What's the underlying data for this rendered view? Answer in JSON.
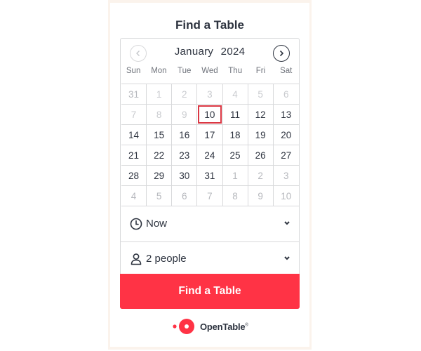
{
  "title": "Find a Table",
  "calendar": {
    "month": "January",
    "year": "2024",
    "weekdays": [
      "Sun",
      "Mon",
      "Tue",
      "Wed",
      "Thu",
      "Fri",
      "Sat"
    ],
    "weeks": [
      [
        {
          "d": "31",
          "s": "muted"
        },
        {
          "d": "1",
          "s": "past"
        },
        {
          "d": "2",
          "s": "past"
        },
        {
          "d": "3",
          "s": "past"
        },
        {
          "d": "4",
          "s": "past"
        },
        {
          "d": "5",
          "s": "past"
        },
        {
          "d": "6",
          "s": "past"
        }
      ],
      [
        {
          "d": "7",
          "s": "past"
        },
        {
          "d": "8",
          "s": "past"
        },
        {
          "d": "9",
          "s": "past"
        },
        {
          "d": "10",
          "s": "selected"
        },
        {
          "d": "11",
          "s": ""
        },
        {
          "d": "12",
          "s": ""
        },
        {
          "d": "13",
          "s": ""
        }
      ],
      [
        {
          "d": "14",
          "s": ""
        },
        {
          "d": "15",
          "s": ""
        },
        {
          "d": "16",
          "s": ""
        },
        {
          "d": "17",
          "s": ""
        },
        {
          "d": "18",
          "s": ""
        },
        {
          "d": "19",
          "s": ""
        },
        {
          "d": "20",
          "s": ""
        }
      ],
      [
        {
          "d": "21",
          "s": ""
        },
        {
          "d": "22",
          "s": ""
        },
        {
          "d": "23",
          "s": ""
        },
        {
          "d": "24",
          "s": ""
        },
        {
          "d": "25",
          "s": ""
        },
        {
          "d": "26",
          "s": ""
        },
        {
          "d": "27",
          "s": ""
        }
      ],
      [
        {
          "d": "28",
          "s": ""
        },
        {
          "d": "29",
          "s": ""
        },
        {
          "d": "30",
          "s": ""
        },
        {
          "d": "31",
          "s": ""
        },
        {
          "d": "1",
          "s": "muted"
        },
        {
          "d": "2",
          "s": "muted"
        },
        {
          "d": "3",
          "s": "muted"
        }
      ],
      [
        {
          "d": "4",
          "s": "muted"
        },
        {
          "d": "5",
          "s": "muted"
        },
        {
          "d": "6",
          "s": "muted"
        },
        {
          "d": "7",
          "s": "muted"
        },
        {
          "d": "8",
          "s": "muted"
        },
        {
          "d": "9",
          "s": "muted"
        },
        {
          "d": "10",
          "s": "muted"
        }
      ]
    ]
  },
  "time": {
    "value": "Now",
    "icon": "clock-icon"
  },
  "party": {
    "value": "2 people",
    "icon": "person-icon"
  },
  "cta_label": "Find a Table",
  "brand": {
    "name": "OpenTable",
    "mark": "®"
  },
  "colors": {
    "accent": "#ff3345",
    "selected_border": "#da3743",
    "text": "#2d333f"
  }
}
